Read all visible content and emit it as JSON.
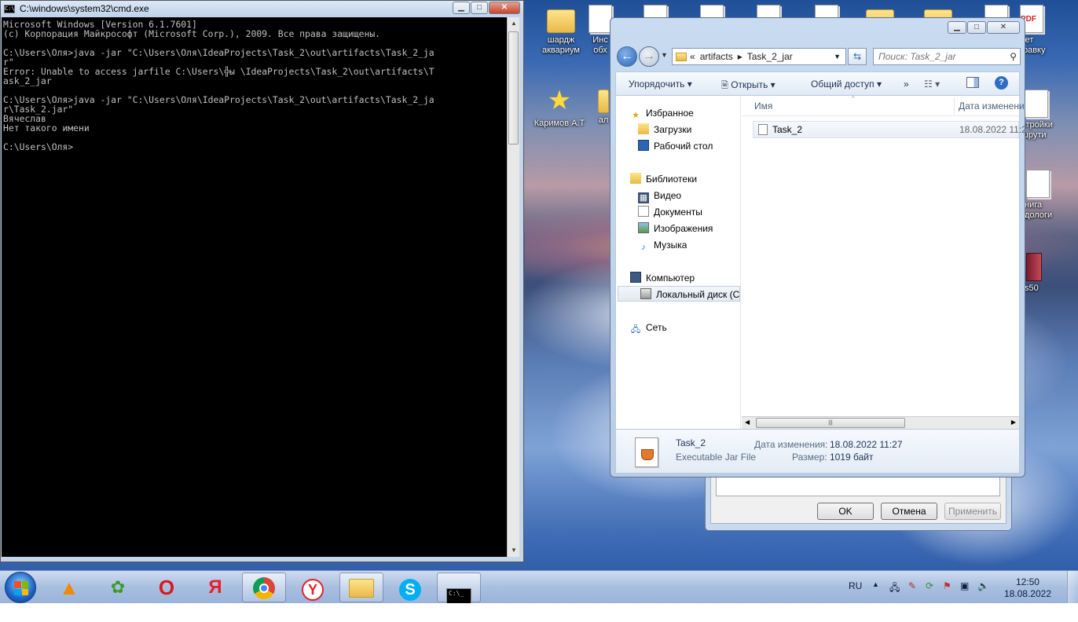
{
  "desktop": {
    "icons": [
      {
        "label": "шардж\nаквариум",
        "icon": "folder-icon"
      },
      {
        "label": "Инс\nобх",
        "icon": "document-icon"
      },
      {
        "label": "Каримов А.Т",
        "icon": "star-icon"
      },
      {
        "label": "ал",
        "icon": "folder-icon"
      },
      {
        "label": "ответ\nправку",
        "icon": "pdf-icon"
      },
      {
        "label": "стройки\nшрути",
        "icon": "document-icon"
      },
      {
        "label": "нига\nдологи",
        "icon": "document-icon"
      },
      {
        "label": "s50",
        "icon": "book-icon"
      }
    ]
  },
  "cmd": {
    "title": "C:\\windows\\system32\\cmd.exe",
    "lines": [
      "Microsoft Windows [Version 6.1.7601]",
      "(c) Корпорация Майкрософт (Microsoft Corp.), 2009. Все права защищены.",
      "",
      "C:\\Users\\Оля>java -jar \"C:\\Users\\Оля\\IdeaProjects\\Task_2\\out\\artifacts\\Task_2_ja",
      "r\"",
      "Error: Unable to access jarfile C:\\Users\\╬ы \\IdeaProjects\\Task_2\\out\\artifacts\\T",
      "ask_2_jar",
      "",
      "C:\\Users\\Оля>java -jar \"C:\\Users\\Оля\\IdeaProjects\\Task_2\\out\\artifacts\\Task_2_ja",
      "r\\Task_2.jar\"",
      "Вячеслав",
      "Нет такого имени",
      "",
      "C:\\Users\\Оля>"
    ]
  },
  "props_dialog": {
    "ok": "OK",
    "cancel": "Отмена",
    "apply": "Применить"
  },
  "explorer": {
    "address": {
      "prefix": "«",
      "crumbs": [
        "artifacts",
        "Task_2_jar"
      ]
    },
    "search_placeholder": "Поиск: Task_2_jar",
    "toolbar": {
      "organize": "Упорядочить",
      "open": "Открыть",
      "share": "Общий доступ",
      "more": "»"
    },
    "nav": {
      "favorites": "Избранное",
      "downloads": "Загрузки",
      "desktop": "Рабочий стол",
      "libraries": "Библиотеки",
      "video": "Видео",
      "documents": "Документы",
      "images": "Изображения",
      "music": "Музыка",
      "computer": "Компьютер",
      "local_disk": "Локальный диск (C",
      "network": "Сеть"
    },
    "columns": {
      "name": "Имя",
      "date": "Дата изменени"
    },
    "files": [
      {
        "name": "Task_2",
        "date": "18.08.2022 11:2"
      }
    ],
    "details": {
      "name": "Task_2",
      "type": "Executable Jar File",
      "date_label": "Дата изменения:",
      "date_value": "18.08.2022 11:27",
      "size_label": "Размер:",
      "size_value": "1019 байт"
    }
  },
  "taskbar": {
    "apps": [
      "vlc-icon",
      "game-icon",
      "opera-icon",
      "yandex-icon",
      "chrome-icon",
      "yandex-browser-icon",
      "explorer-icon",
      "skype-icon",
      "cmd-icon"
    ],
    "lang": "RU",
    "time": "12:50",
    "date": "18.08.2022"
  }
}
